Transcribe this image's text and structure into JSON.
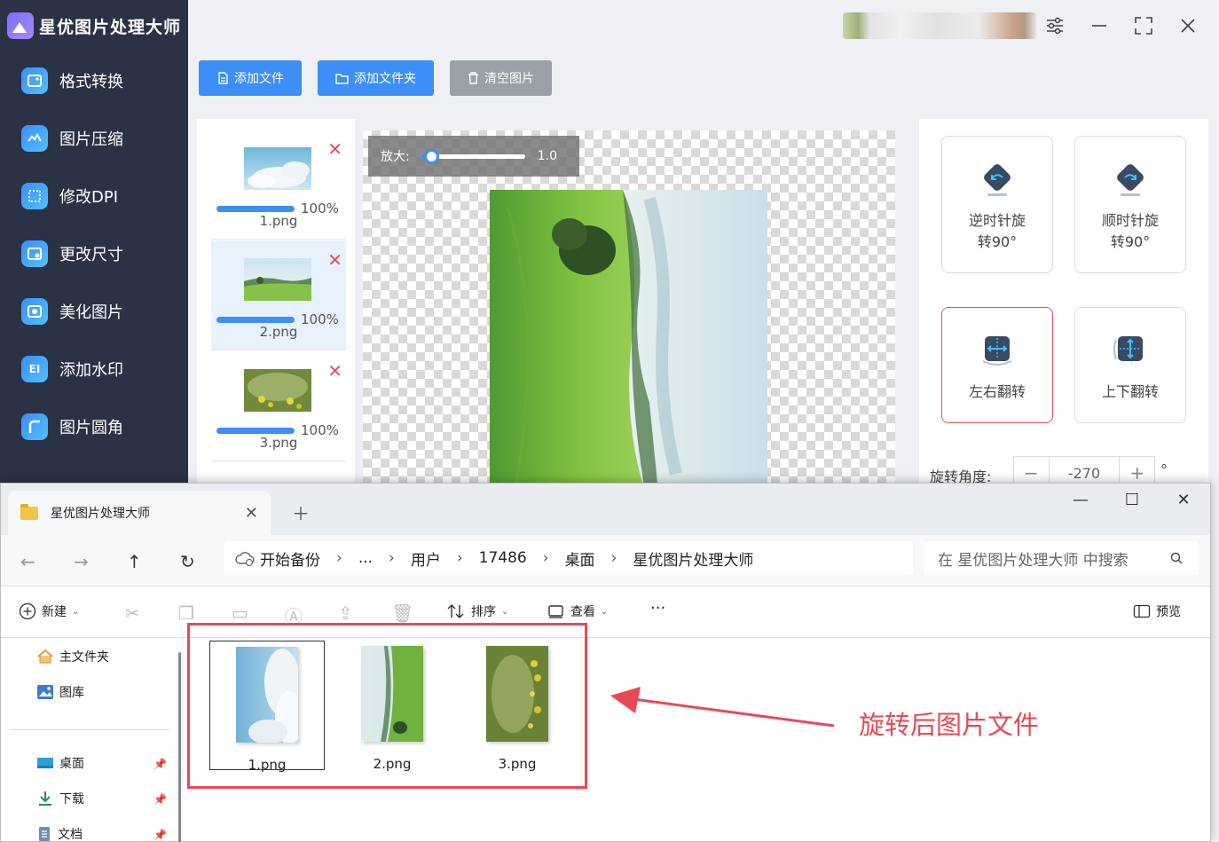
{
  "app": {
    "title": "星优图片处理大师",
    "nav": [
      "格式转换",
      "图片压缩",
      "修改DPI",
      "更改尺寸",
      "美化图片",
      "添加水印",
      "图片圆角"
    ],
    "nav_icon_glyphs": [
      "",
      "",
      "",
      "",
      "",
      "EI",
      ""
    ],
    "toolbar": {
      "add_file": "添加文件",
      "add_folder": "添加文件夹",
      "clear": "清空图片"
    },
    "files": [
      {
        "name": "1.png",
        "progress": "100%"
      },
      {
        "name": "2.png",
        "progress": "100%"
      },
      {
        "name": "3.png",
        "progress": "100%"
      }
    ],
    "zoom": {
      "label": "放大:",
      "value": "1.0"
    },
    "controls": {
      "ccw": [
        "逆时针旋",
        "转90°"
      ],
      "cw": [
        "顺时针旋",
        "转90°"
      ],
      "flip_h": "左右翻转",
      "flip_v": "上下翻转",
      "angle_label": "旋转角度:",
      "angle_minus": "−",
      "angle_value": "-270",
      "angle_plus": "+",
      "angle_unit": "°"
    },
    "accent": "#3e8ef7"
  },
  "explorer": {
    "tab_title": "星优图片处理大师",
    "breadcrumbs": [
      "开始备份",
      "...",
      "用户",
      "17486",
      "桌面",
      "星优图片处理大师"
    ],
    "search_placeholder": "在 星优图片处理大师 中搜索",
    "commands": {
      "new": "新建",
      "sort": "排序",
      "view": "查看",
      "more": "···",
      "preview": "预览"
    },
    "nav_pane": [
      "主文件夹",
      "图库",
      "桌面",
      "下载",
      "文档"
    ],
    "files": [
      "1.png",
      "2.png",
      "3.png"
    ]
  },
  "annotation": {
    "text": "旋转后图片文件",
    "color": "#e84a55"
  }
}
